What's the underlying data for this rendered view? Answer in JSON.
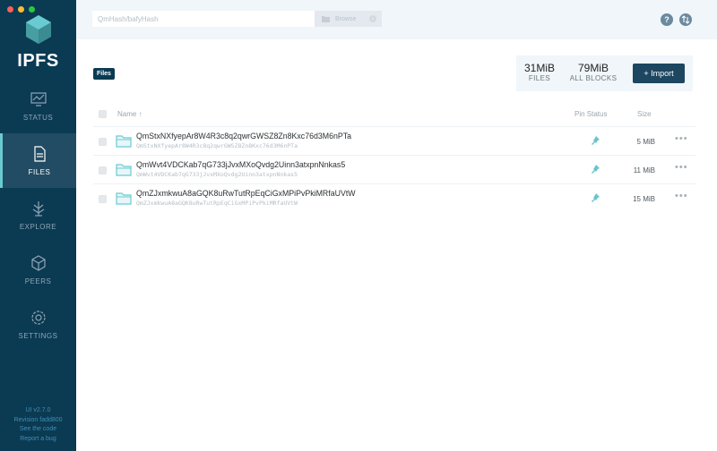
{
  "sidebar": {
    "logo_text": "IPFS",
    "items": [
      {
        "label": "STATUS",
        "icon": "status-icon"
      },
      {
        "label": "FILES",
        "icon": "files-icon",
        "active": true
      },
      {
        "label": "EXPLORE",
        "icon": "explore-icon"
      },
      {
        "label": "PEERS",
        "icon": "peers-icon"
      },
      {
        "label": "SETTINGS",
        "icon": "settings-icon"
      }
    ],
    "footer": {
      "version": "UI v2.7.0",
      "revision": "Revision fadd800",
      "see_code": "See the code",
      "report_bug": "Report a bug"
    }
  },
  "topbar": {
    "path_placeholder": "QmHash/bafyHash",
    "browse_label": "Browse"
  },
  "breadcrumb": {
    "label": "Files"
  },
  "stats": {
    "files_value": "31MiB",
    "files_label": "FILES",
    "blocks_value": "79MiB",
    "blocks_label": "ALL BLOCKS"
  },
  "import_label": "+ Import",
  "table": {
    "headers": {
      "name": "Name ↑",
      "pin": "Pin Status",
      "size": "Size"
    },
    "rows": [
      {
        "name": "QmStxNXfyepAr8W4R3c8q2qwrGWSZ8Zn8Kxc76d3M6nPTa",
        "cid": "QmStxNXfyepAr8W4R3c8q2qwrGWSZ8Zn8Kxc76d3M6nPTa",
        "size": "5 MiB"
      },
      {
        "name": "QmWvt4VDCKab7qG733jJvxMXoQvdg2Uinn3atxpnNnkas5",
        "cid": "QmWvt4VDCKab7qG733jJvxMXoQvdg2Uinn3atxpnNnkas5",
        "size": "11 MiB"
      },
      {
        "name": "QmZJxmkwuA8aGQK8uRwTutRpEqCiGxMPiPvPkiMRfaUVtW",
        "cid": "QmZJxmkwuA8aGQK8uRwTutRpEqCiGxMPiPvPkiMRfaUVtW",
        "size": "15 MiB"
      }
    ]
  },
  "colors": {
    "sidebar_bg": "#0b3a53",
    "accent": "#1d4660",
    "folder": "#6acad1",
    "pin": "#69c4cd"
  }
}
